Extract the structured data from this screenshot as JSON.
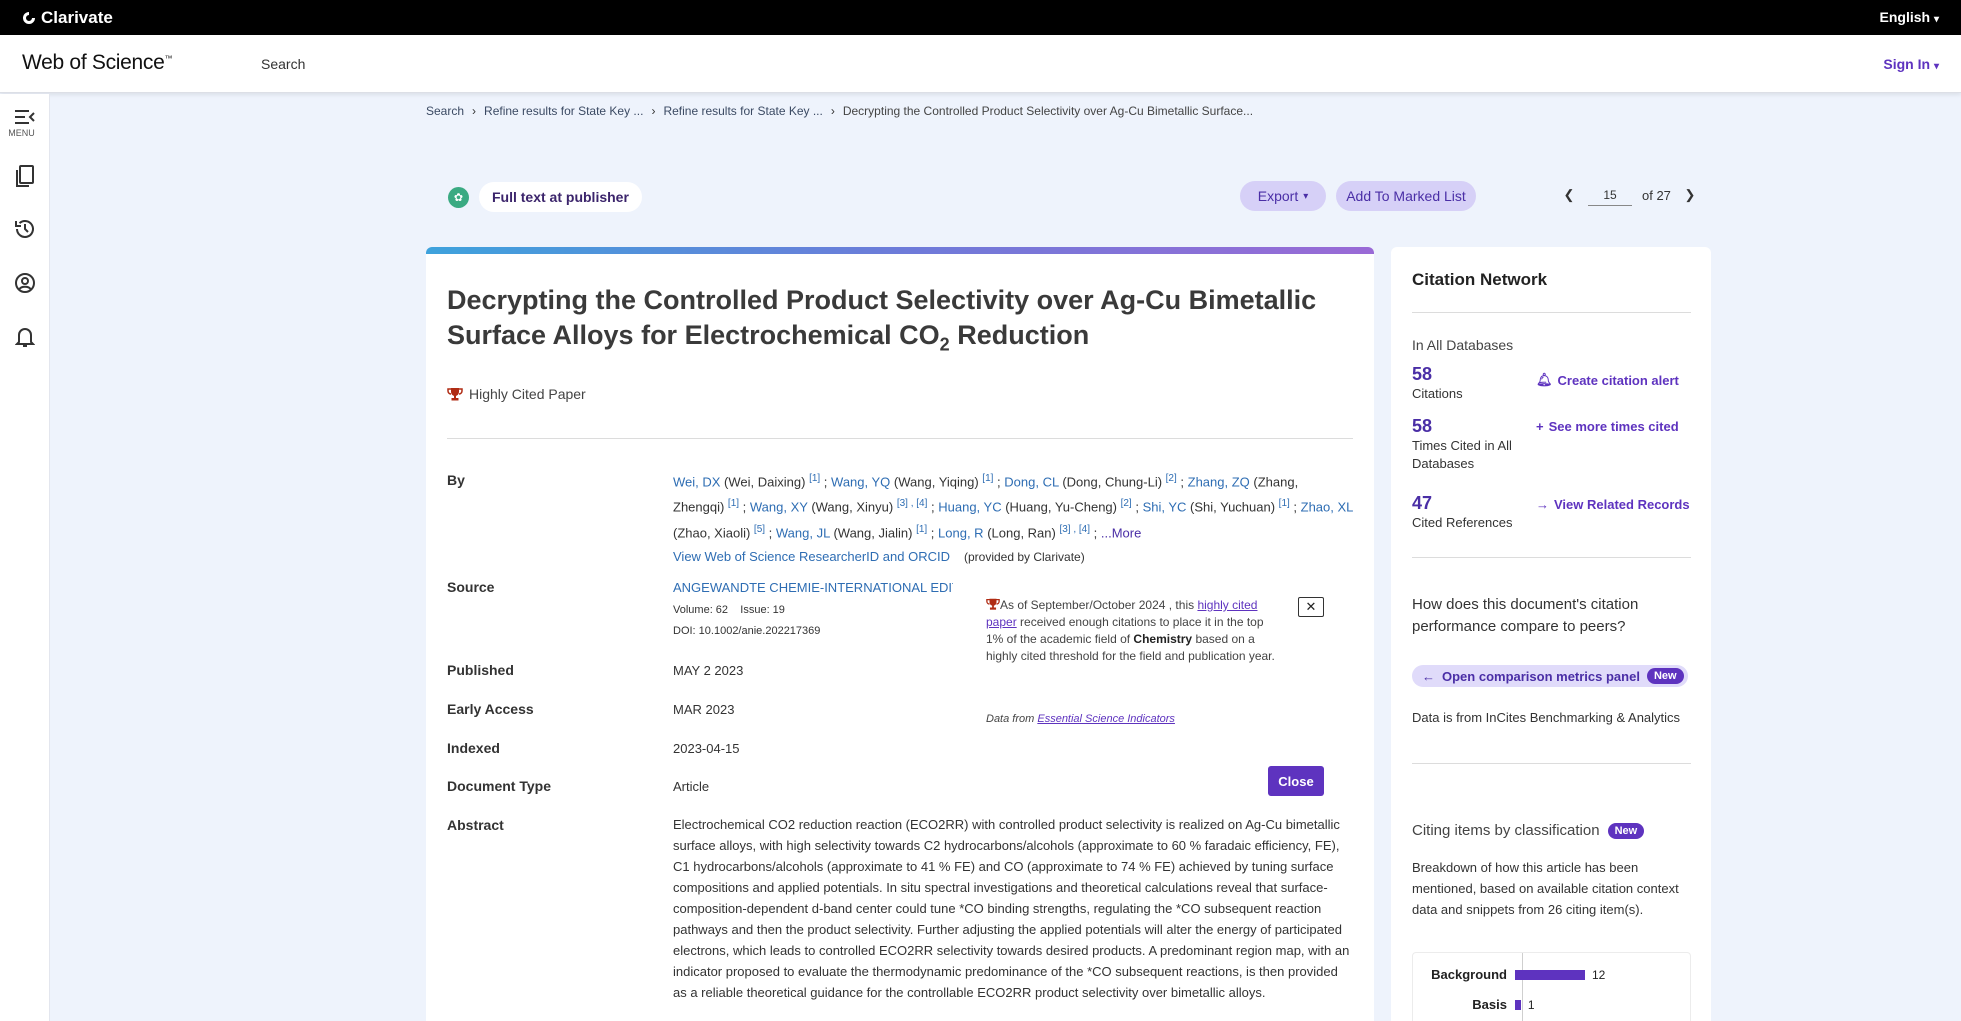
{
  "topbar": {
    "brand": "Clarivate",
    "language": "English"
  },
  "header": {
    "product": "Web of Science",
    "trademark": "™",
    "search_link": "Search",
    "signin": "Sign In"
  },
  "sidenav": {
    "menu_label": "MENU",
    "items": [
      "menu-icon",
      "bookmark-icon",
      "history-icon",
      "profile-icon",
      "bell-icon"
    ]
  },
  "breadcrumb": [
    "Search",
    "Refine results for State Key ...",
    "Refine results for State Key ...",
    "Decrypting the Controlled Product Selectivity over Ag-Cu Bimetallic Surface..."
  ],
  "toolbar": {
    "full_text": "Full text at publisher",
    "export": "Export",
    "add_marked": "Add To Marked List",
    "page_current": "15",
    "page_of": "of 27"
  },
  "record": {
    "title_main": "Decrypting the Controlled Product Selectivity over Ag-Cu Bimetallic Surface Alloys for Electrochemical CO",
    "title_sub": "2",
    "title_end": " Reduction",
    "highly_cited": "Highly Cited Paper",
    "labels": {
      "by": "By",
      "source": "Source",
      "published": "Published",
      "early_access": "Early Access",
      "indexed": "Indexed",
      "doc_type": "Document Type",
      "abstract": "Abstract"
    },
    "authors": [
      {
        "short": "Wei, DX",
        "full": "(Wei, Daixing)",
        "refs": "[1]",
        "sep": " ; "
      },
      {
        "short": "Wang, YQ",
        "full": "(Wang, Yiqing)",
        "refs": "[1]",
        "sep": " ; "
      },
      {
        "short": "Dong, CL",
        "full": "(Dong, Chung-Li)",
        "refs": "[2]",
        "sep": " ; "
      },
      {
        "short": "Zhang, ZQ",
        "full": "(Zhang, Zhengqi)",
        "refs": "[1]",
        "sep": " ; "
      },
      {
        "short": "Wang, XY",
        "full": "(Wang, Xinyu)",
        "refs": "[3] , [4]",
        "sep": " ; "
      },
      {
        "short": "Huang, YC",
        "full": "(Huang, Yu-Cheng)",
        "refs": "[2]",
        "sep": " ; "
      },
      {
        "short": "Shi, YC",
        "full": "(Shi, Yuchuan)",
        "refs": "[1]",
        "sep": " ; "
      },
      {
        "short": "Zhao, XL",
        "full": "(Zhao, Xiaoli)",
        "refs": "[5]",
        "sep": " ; "
      },
      {
        "short": "Wang, JL",
        "full": "(Wang, Jialin)",
        "refs": "[1]",
        "sep": " ; "
      },
      {
        "short": "Long, R",
        "full": "(Long, Ran)",
        "refs": "[3] , [4]",
        "sep": " ; "
      }
    ],
    "authors_more": "...More",
    "researcher_link": "View Web of Science ResearcherID and ORCID",
    "provided_by": "(provided by Clarivate)",
    "journal": "ANGEWANDTE CHEMIE-INTERNATIONAL EDITION",
    "volume": "Volume: 62",
    "issue": "Issue: 19",
    "doi": "DOI: 10.1002/anie.202217369",
    "published": "MAY 2 2023",
    "early_access": "MAR 2023",
    "indexed": "2023-04-15",
    "doc_type": "Article",
    "abstract": "Electrochemical CO2 reduction reaction (ECO2RR) with controlled product selectivity is realized on Ag-Cu bimetallic surface alloys, with high selectivity towards C2 hydrocarbons/alcohols (approximate to 60 % faradaic efficiency, FE), C1 hydrocarbons/alcohols (approximate to 41 % FE) and CO (approximate to 74 % FE) achieved by tuning surface compositions and applied potentials. In situ spectral investigations and theoretical calculations reveal that surface-composition-dependent d-band center could tune *CO binding strengths, regulating the *CO subsequent reaction pathways and then the product selectivity. Further adjusting the applied potentials will alter the energy of participated electrons, which leads to controlled ECO2RR selectivity towards desired products. A predominant region map, with an indicator proposed to evaluate the thermodynamic predominance of the *CO subsequent reactions, is then provided as a reliable theoretical guidance for the controllable ECO2RR product selectivity over bimetallic alloys."
  },
  "popup": {
    "text_pre": "As of September/October 2024 , this ",
    "link1": "highly cited paper",
    "text_mid": " received enough citations to place it in the top 1% of the academic field of ",
    "field": "Chemistry",
    "text_post": " based on a highly cited threshold for the field and publication year.",
    "data_from": "Data from ",
    "esi_link": "Essential Science Indicators",
    "close_x": "✕",
    "close_button": "Close"
  },
  "citation_network": {
    "heading": "Citation Network",
    "in_all": "In All Databases",
    "citations_count": "58",
    "citations_label": "Citations",
    "times_cited_count": "58",
    "times_cited_label": "Times Cited in All Databases",
    "cited_refs_count": "47",
    "cited_refs_label": "Cited References",
    "create_alert": "Create citation alert",
    "see_more": "See more times cited",
    "view_related": "View Related Records",
    "question": "How does this document's citation performance compare to peers?",
    "open_panel": "Open comparison metrics panel",
    "new_badge": "New",
    "data_incites": "Data is from InCites Benchmarking & Analytics",
    "citing_by_class": "Citing items by classification",
    "breakdown": "Breakdown of how this article has been mentioned, based on available citation context data and snippets from 26 citing item(s).",
    "colors": {
      "accent": "#5e33bf"
    }
  },
  "chart_data": {
    "type": "bar",
    "categories": [
      "Background",
      "Basis"
    ],
    "values": [
      12,
      1
    ]
  }
}
